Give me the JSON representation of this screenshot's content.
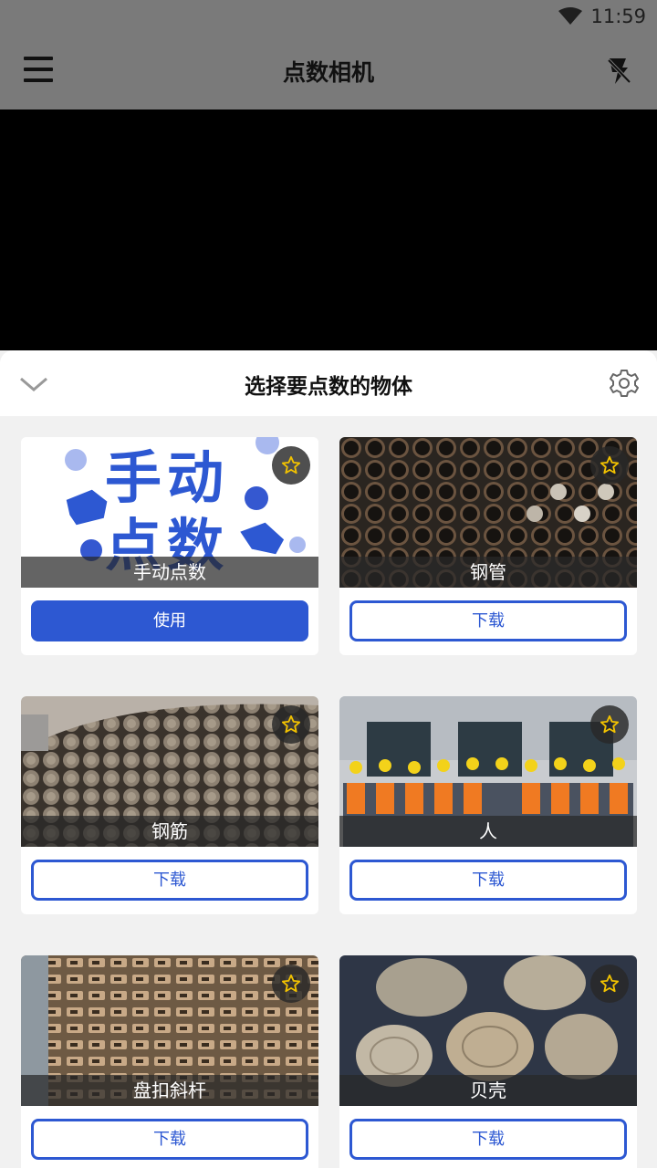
{
  "status_bar": {
    "time": "11:59",
    "wifi_icon": "wifi-icon"
  },
  "app_bar": {
    "title": "点数相机",
    "menu_icon": "menu-icon",
    "flash_icon": "flash-off-icon"
  },
  "sheet": {
    "title": "选择要点数的物体",
    "collapse_icon": "chevron-down-icon",
    "settings_icon": "gear-icon"
  },
  "items": [
    {
      "label": "手动点数",
      "button": "使用",
      "button_style": "primary",
      "thumb_text": [
        "手动",
        "点数"
      ]
    },
    {
      "label": "钢管",
      "button": "下载",
      "button_style": "outline"
    },
    {
      "label": "钢筋",
      "button": "下载",
      "button_style": "outline"
    },
    {
      "label": "人",
      "button": "下载",
      "button_style": "outline"
    },
    {
      "label": "盘扣斜杆",
      "button": "下载",
      "button_style": "outline"
    },
    {
      "label": "贝壳",
      "button": "下载",
      "button_style": "outline"
    }
  ],
  "colors": {
    "accent": "#2d58d2",
    "header_gray": "#7a7a7a",
    "star_yellow": "#f2c200"
  }
}
